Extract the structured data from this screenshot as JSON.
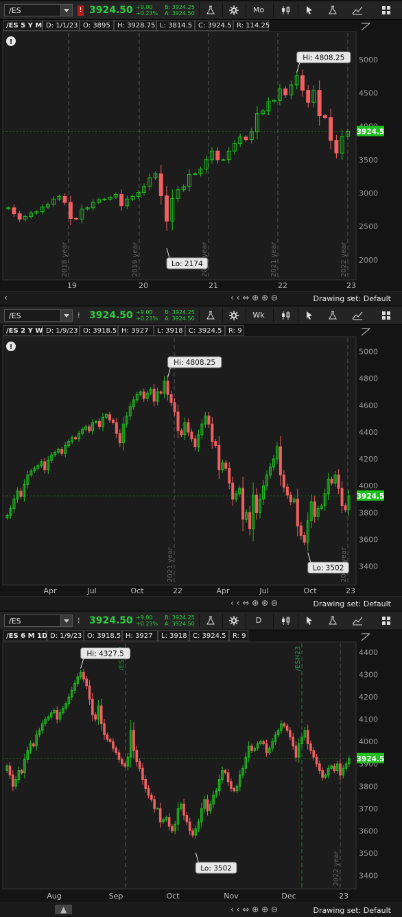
{
  "panels": [
    {
      "symbol": "/ES",
      "flag": "!",
      "last": "3924.50",
      "change": "+9.00",
      "change_pct": "+0.23%",
      "bid": "B: 3924.25",
      "ask": "A: 3924.50",
      "aggregation": "Mo",
      "info": {
        "title": "/ES 5 Y M",
        "date": "D: 1/1/23",
        "open": "O: 3895",
        "high": "H: 3928.75",
        "low": "L: 3814.5",
        "close": "C: 3924.5",
        "range": "R: 114.25"
      },
      "drawing_set": "Drawing set: Default"
    },
    {
      "symbol": "/ES",
      "flag": "",
      "last": "3924.50",
      "change": "+9.00",
      "change_pct": "+0.23%",
      "bid": "B: 3924.25",
      "ask": "A: 3924.50",
      "aggregation": "Wk",
      "info": {
        "title": "/ES 2 Y W",
        "date": "D: 1/9/23",
        "open": "O: 3918.5",
        "high": "H: 3927",
        "low": "L: 3918",
        "close": "C: 3924.5",
        "range": "R: 9"
      },
      "drawing_set": "Drawing set: Default"
    },
    {
      "symbol": "/ES",
      "flag": "",
      "last": "3924.50",
      "change": "+9.00",
      "change_pct": "+0.23%",
      "bid": "B: 3924.25",
      "ask": "A: 3924.50",
      "aggregation": "D",
      "info": {
        "title": "/ES 6 M 1D",
        "date": "D: 1/9/23",
        "open": "O: 3918.5",
        "high": "H: 3927",
        "low": "L: 3918",
        "close": "C: 3924.5",
        "range": "R: 9"
      },
      "drawing_set": "Drawing set: Default"
    }
  ],
  "colors": {
    "up": "#1fbf1f",
    "down": "#f06060",
    "last_label_bg": "#1fbf1f",
    "bg": "#141414",
    "grid_line": "#4a4a4a"
  },
  "chart_data": [
    {
      "type": "candlestick",
      "ylim": [
        1700,
        5400
      ],
      "yticks": [
        2000,
        2500,
        3000,
        3500,
        4000,
        4500,
        5000
      ],
      "xticks": [
        "19",
        "20",
        "21",
        "22",
        "23"
      ],
      "year_markers": [
        "2018 year",
        "2019 year",
        "2020 year",
        "2021 year",
        "2022 year"
      ],
      "annotations": [
        {
          "text": "Hi: 4808.25",
          "value": 4808.25
        },
        {
          "text": "Lo: 2174",
          "value": 2174
        }
      ],
      "last_price": "3924.5",
      "x_index": [
        0,
        1,
        2,
        3,
        4,
        5,
        6,
        7,
        8,
        9,
        10,
        11,
        12,
        13,
        14,
        15,
        16,
        17,
        18,
        19,
        20,
        21,
        22,
        23,
        24,
        25,
        26,
        27,
        28,
        29,
        30,
        31,
        32,
        33,
        34,
        35,
        36,
        37,
        38,
        39,
        40,
        41,
        42,
        43,
        44,
        45,
        46,
        47,
        48,
        49,
        50,
        51,
        52,
        53,
        54,
        55,
        56,
        57,
        58,
        59,
        60
      ],
      "close": [
        2780,
        2690,
        2610,
        2650,
        2700,
        2720,
        2790,
        2830,
        2910,
        2950,
        2860,
        2620,
        2610,
        2760,
        2780,
        2860,
        2900,
        2910,
        2940,
        2980,
        2810,
        2910,
        2950,
        3010,
        3100,
        3230,
        3290,
        2960,
        2580,
        2920,
        3050,
        3100,
        3280,
        3290,
        3360,
        3500,
        3630,
        3500,
        3500,
        3630,
        3740,
        3840,
        3800,
        3920,
        4190,
        4230,
        4370,
        4390,
        4560,
        4470,
        4620,
        4760,
        4540,
        4360,
        4540,
        4160,
        4130,
        3790,
        3600,
        3850,
        3924.5
      ]
    },
    {
      "type": "candlestick",
      "ylim": [
        3260,
        5100
      ],
      "yticks": [
        3400,
        3600,
        3800,
        4000,
        4200,
        4400,
        4600,
        4800,
        5000
      ],
      "xticks": [
        "Apr",
        "Jul",
        "Oct",
        "22",
        "Apr",
        "Jul",
        "Oct",
        "23"
      ],
      "year_markers": [
        "2021 year",
        "2022 year"
      ],
      "annotations": [
        {
          "text": "Hi: 4808.25",
          "value": 4808.25
        },
        {
          "text": "Lo: 3502",
          "value": 3502
        }
      ],
      "last_price": "3924.5",
      "close": [
        3780,
        3830,
        3900,
        3960,
        3920,
        4010,
        4080,
        4110,
        4130,
        4150,
        4180,
        4120,
        4190,
        4230,
        4250,
        4270,
        4240,
        4300,
        4330,
        4360,
        4350,
        4390,
        4420,
        4440,
        4410,
        4470,
        4480,
        4440,
        4510,
        4530,
        4490,
        4470,
        4390,
        4320,
        4460,
        4520,
        4590,
        4640,
        4680,
        4700,
        4650,
        4690,
        4720,
        4630,
        4700,
        4690,
        4780,
        4680,
        4620,
        4550,
        4410,
        4380,
        4470,
        4400,
        4350,
        4290,
        4380,
        4460,
        4520,
        4460,
        4330,
        4300,
        4120,
        4170,
        4130,
        4020,
        3900,
        3940,
        3980,
        3750,
        3800,
        3680,
        3930,
        3800,
        3900,
        4000,
        4080,
        4140,
        4200,
        4290,
        4080,
        3990,
        3930,
        3880,
        3900,
        3700,
        3630,
        3580,
        3740,
        3880,
        3770,
        3830,
        3850,
        3940,
        4050,
        4020,
        4080,
        3980,
        3850,
        3820,
        3924.5
      ]
    },
    {
      "type": "candlestick",
      "ylim": [
        3340,
        4440
      ],
      "yticks": [
        3400,
        3500,
        3600,
        3700,
        3800,
        3900,
        4000,
        4100,
        4200,
        4300,
        4400
      ],
      "xticks": [
        "Aug",
        "Sep",
        "Oct",
        "Nov",
        "Dec",
        "23"
      ],
      "year_markers": [
        "/ESZ22",
        "/ESH23",
        "2022 year"
      ],
      "annotations": [
        {
          "text": "Hi: 4327.5",
          "value": 4327.5
        },
        {
          "text": "Lo: 3502",
          "value": 3502
        }
      ],
      "last_price": "3924.5",
      "close": [
        3890,
        3850,
        3800,
        3830,
        3870,
        3860,
        3920,
        3960,
        3990,
        3980,
        4030,
        4050,
        4080,
        4100,
        4110,
        4130,
        4140,
        4100,
        4130,
        4150,
        4170,
        4200,
        4230,
        4260,
        4290,
        4310,
        4280,
        4250,
        4190,
        4120,
        4100,
        4160,
        4080,
        4030,
        4010,
        4000,
        3970,
        3950,
        3920,
        3900,
        3890,
        3930,
        4050,
        3960,
        3910,
        3880,
        3830,
        3790,
        3760,
        3740,
        3700,
        3700,
        3640,
        3650,
        3660,
        3620,
        3600,
        3630,
        3700,
        3720,
        3670,
        3640,
        3600,
        3580,
        3610,
        3640,
        3700,
        3740,
        3690,
        3720,
        3760,
        3780,
        3830,
        3870,
        3860,
        3820,
        3790,
        3780,
        3800,
        3850,
        3880,
        3930,
        3980,
        3960,
        3970,
        3990,
        4000,
        3990,
        3950,
        3970,
        4000,
        4030,
        4050,
        4080,
        4070,
        4050,
        4020,
        3980,
        3930,
        3990,
        4020,
        4050,
        3990,
        3960,
        3930,
        3900,
        3870,
        3840,
        3850,
        3880,
        3890,
        3870,
        3900,
        3850,
        3880,
        3900,
        3924.5
      ]
    }
  ]
}
